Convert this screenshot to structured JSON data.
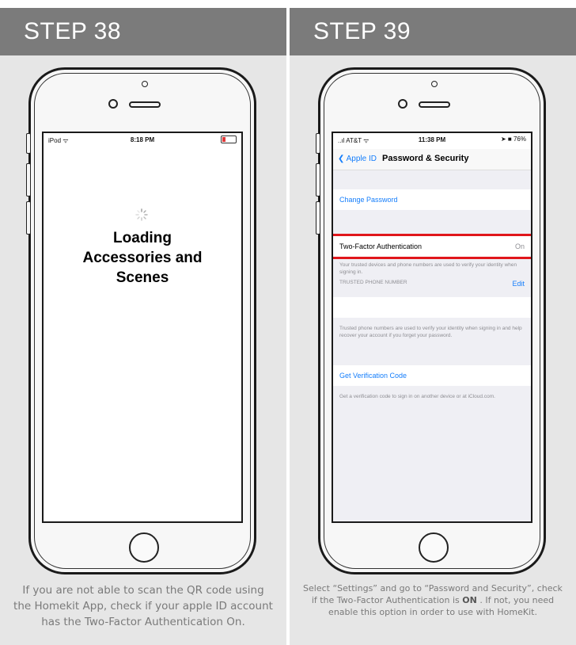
{
  "steps": [
    {
      "header": "STEP 38",
      "status": {
        "left": "iPod ᯤ",
        "time": "8:18 PM"
      },
      "loading_text": "Loading Accessories and Scenes",
      "caption": "If you are not able to scan the QR code using the Homekit App, check if your apple ID account has the Two-Factor Authentication On."
    },
    {
      "header": "STEP 39",
      "status": {
        "left": "..ıl AT&T ᯤ",
        "time": "11:38 PM",
        "right": "➤ ■ 76%"
      },
      "nav": {
        "back_label": "Apple ID",
        "title": "Password & Security"
      },
      "change_password": "Change Password",
      "two_factor": {
        "label": "Two-Factor Authentication",
        "value": "On"
      },
      "two_factor_note": "Your trusted devices and phone numbers are used to verify your identity when signing in.",
      "trusted_header": "TRUSTED PHONE NUMBER",
      "edit_label": "Edit",
      "trusted_note": "Trusted phone numbers are used to verify your identity when signing in and help recover your account if you forget your password.",
      "get_code": "Get Verification Code",
      "get_code_note": "Get a verification code to sign in on another device or at iCloud.com.",
      "caption_part1": "Select “Settings” and go to “Password and Security”, check if the Two-Factor Authentication is ",
      "caption_bold": "ON",
      "caption_part2": " . If not, you need enable this option in order to use with HomeKit."
    }
  ],
  "colors": {
    "header_bg": "#7b7b7b",
    "highlight": "#e0161b",
    "ios_blue": "#157efb"
  }
}
